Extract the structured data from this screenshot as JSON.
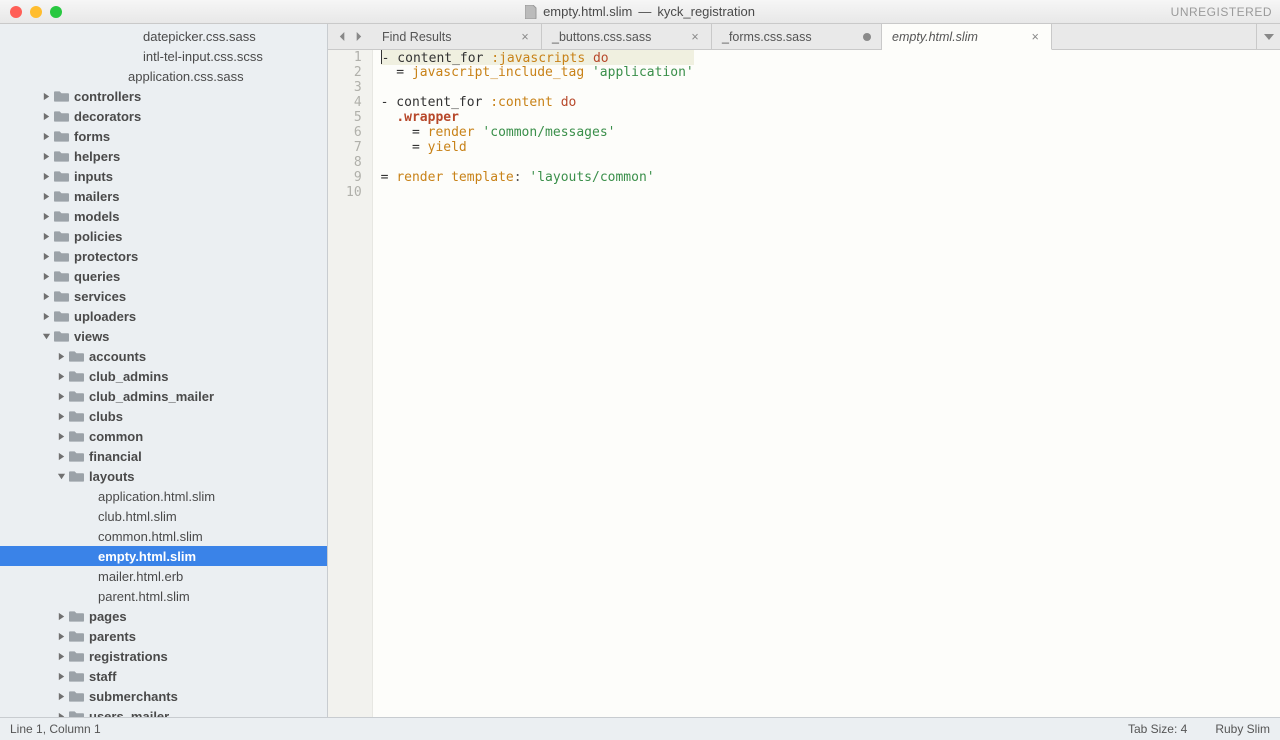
{
  "window": {
    "file": "empty.html.slim",
    "separator": "—",
    "project": "kyck_registration",
    "unregistered": "UNREGISTERED"
  },
  "tabs": [
    {
      "label": "Find Results",
      "kind": "close",
      "active": false
    },
    {
      "label": "_buttons.css.sass",
      "kind": "close",
      "active": false
    },
    {
      "label": "_forms.css.sass",
      "kind": "dirty",
      "active": false
    },
    {
      "label": "empty.html.slim",
      "kind": "close",
      "active": true
    }
  ],
  "sidebar": {
    "items": [
      {
        "label": "datepicker.css.sass",
        "type": "file",
        "depth": 7,
        "bold": false
      },
      {
        "label": "intl-tel-input.css.scss",
        "type": "file",
        "depth": 7,
        "bold": false
      },
      {
        "label": "application.css.sass",
        "type": "file",
        "depth": 6,
        "bold": false
      },
      {
        "label": "controllers",
        "type": "folder",
        "depth": 2,
        "expanded": false,
        "bold": true
      },
      {
        "label": "decorators",
        "type": "folder",
        "depth": 2,
        "expanded": false,
        "bold": true
      },
      {
        "label": "forms",
        "type": "folder",
        "depth": 2,
        "expanded": false,
        "bold": true
      },
      {
        "label": "helpers",
        "type": "folder",
        "depth": 2,
        "expanded": false,
        "bold": true
      },
      {
        "label": "inputs",
        "type": "folder",
        "depth": 2,
        "expanded": false,
        "bold": true
      },
      {
        "label": "mailers",
        "type": "folder",
        "depth": 2,
        "expanded": false,
        "bold": true
      },
      {
        "label": "models",
        "type": "folder",
        "depth": 2,
        "expanded": false,
        "bold": true
      },
      {
        "label": "policies",
        "type": "folder",
        "depth": 2,
        "expanded": false,
        "bold": true
      },
      {
        "label": "protectors",
        "type": "folder",
        "depth": 2,
        "expanded": false,
        "bold": true
      },
      {
        "label": "queries",
        "type": "folder",
        "depth": 2,
        "expanded": false,
        "bold": true
      },
      {
        "label": "services",
        "type": "folder",
        "depth": 2,
        "expanded": false,
        "bold": true
      },
      {
        "label": "uploaders",
        "type": "folder",
        "depth": 2,
        "expanded": false,
        "bold": true
      },
      {
        "label": "views",
        "type": "folder",
        "depth": 2,
        "expanded": true,
        "bold": true
      },
      {
        "label": "accounts",
        "type": "folder",
        "depth": 3,
        "expanded": false,
        "bold": true
      },
      {
        "label": "club_admins",
        "type": "folder",
        "depth": 3,
        "expanded": false,
        "bold": true
      },
      {
        "label": "club_admins_mailer",
        "type": "folder",
        "depth": 3,
        "expanded": false,
        "bold": true
      },
      {
        "label": "clubs",
        "type": "folder",
        "depth": 3,
        "expanded": false,
        "bold": true
      },
      {
        "label": "common",
        "type": "folder",
        "depth": 3,
        "expanded": false,
        "bold": true
      },
      {
        "label": "financial",
        "type": "folder",
        "depth": 3,
        "expanded": false,
        "bold": true
      },
      {
        "label": "layouts",
        "type": "folder",
        "depth": 3,
        "expanded": true,
        "bold": true
      },
      {
        "label": "application.html.slim",
        "type": "file",
        "depth": 4,
        "bold": false
      },
      {
        "label": "club.html.slim",
        "type": "file",
        "depth": 4,
        "bold": false
      },
      {
        "label": "common.html.slim",
        "type": "file",
        "depth": 4,
        "bold": false
      },
      {
        "label": "empty.html.slim",
        "type": "file",
        "depth": 4,
        "bold": true,
        "selected": true
      },
      {
        "label": "mailer.html.erb",
        "type": "file",
        "depth": 4,
        "bold": false
      },
      {
        "label": "parent.html.slim",
        "type": "file",
        "depth": 4,
        "bold": false
      },
      {
        "label": "pages",
        "type": "folder",
        "depth": 3,
        "expanded": false,
        "bold": true
      },
      {
        "label": "parents",
        "type": "folder",
        "depth": 3,
        "expanded": false,
        "bold": true
      },
      {
        "label": "registrations",
        "type": "folder",
        "depth": 3,
        "expanded": false,
        "bold": true
      },
      {
        "label": "staff",
        "type": "folder",
        "depth": 3,
        "expanded": false,
        "bold": true
      },
      {
        "label": "submerchants",
        "type": "folder",
        "depth": 3,
        "expanded": false,
        "bold": true
      },
      {
        "label": "users_mailer",
        "type": "folder",
        "depth": 3,
        "expanded": false,
        "bold": true
      }
    ]
  },
  "code": {
    "lines": [
      {
        "n": 1,
        "hl": true,
        "tokens": [
          {
            "t": "- content_for ",
            "c": ""
          },
          {
            "t": ":javascripts",
            "c": "tok-sym"
          },
          {
            "t": " ",
            "c": ""
          },
          {
            "t": "do",
            "c": "tok-do"
          }
        ]
      },
      {
        "n": 2,
        "tokens": [
          {
            "t": "  = ",
            "c": ""
          },
          {
            "t": "javascript_include_tag",
            "c": "tok-kw"
          },
          {
            "t": " ",
            "c": ""
          },
          {
            "t": "'application'",
            "c": "tok-str"
          }
        ]
      },
      {
        "n": 3,
        "tokens": []
      },
      {
        "n": 4,
        "tokens": [
          {
            "t": "- content_for ",
            "c": ""
          },
          {
            "t": ":content",
            "c": "tok-sym"
          },
          {
            "t": " ",
            "c": ""
          },
          {
            "t": "do",
            "c": "tok-do"
          }
        ]
      },
      {
        "n": 5,
        "tokens": [
          {
            "t": "  ",
            "c": ""
          },
          {
            "t": ".wrapper",
            "c": "tok-cls"
          }
        ]
      },
      {
        "n": 6,
        "tokens": [
          {
            "t": "    = ",
            "c": ""
          },
          {
            "t": "render",
            "c": "tok-kw"
          },
          {
            "t": " ",
            "c": ""
          },
          {
            "t": "'common/messages'",
            "c": "tok-str"
          }
        ]
      },
      {
        "n": 7,
        "tokens": [
          {
            "t": "    = ",
            "c": ""
          },
          {
            "t": "yield",
            "c": "tok-kw"
          }
        ]
      },
      {
        "n": 8,
        "tokens": []
      },
      {
        "n": 9,
        "tokens": [
          {
            "t": "= ",
            "c": ""
          },
          {
            "t": "render",
            "c": "tok-kw"
          },
          {
            "t": " ",
            "c": ""
          },
          {
            "t": "template",
            "c": "tok-kw"
          },
          {
            "t": ": ",
            "c": "tok-punc"
          },
          {
            "t": "'layouts/common'",
            "c": "tok-str"
          }
        ]
      },
      {
        "n": 10,
        "tokens": []
      }
    ]
  },
  "status": {
    "pos": "Line 1, Column 1",
    "tab": "Tab Size: 4",
    "lang": "Ruby Slim"
  }
}
